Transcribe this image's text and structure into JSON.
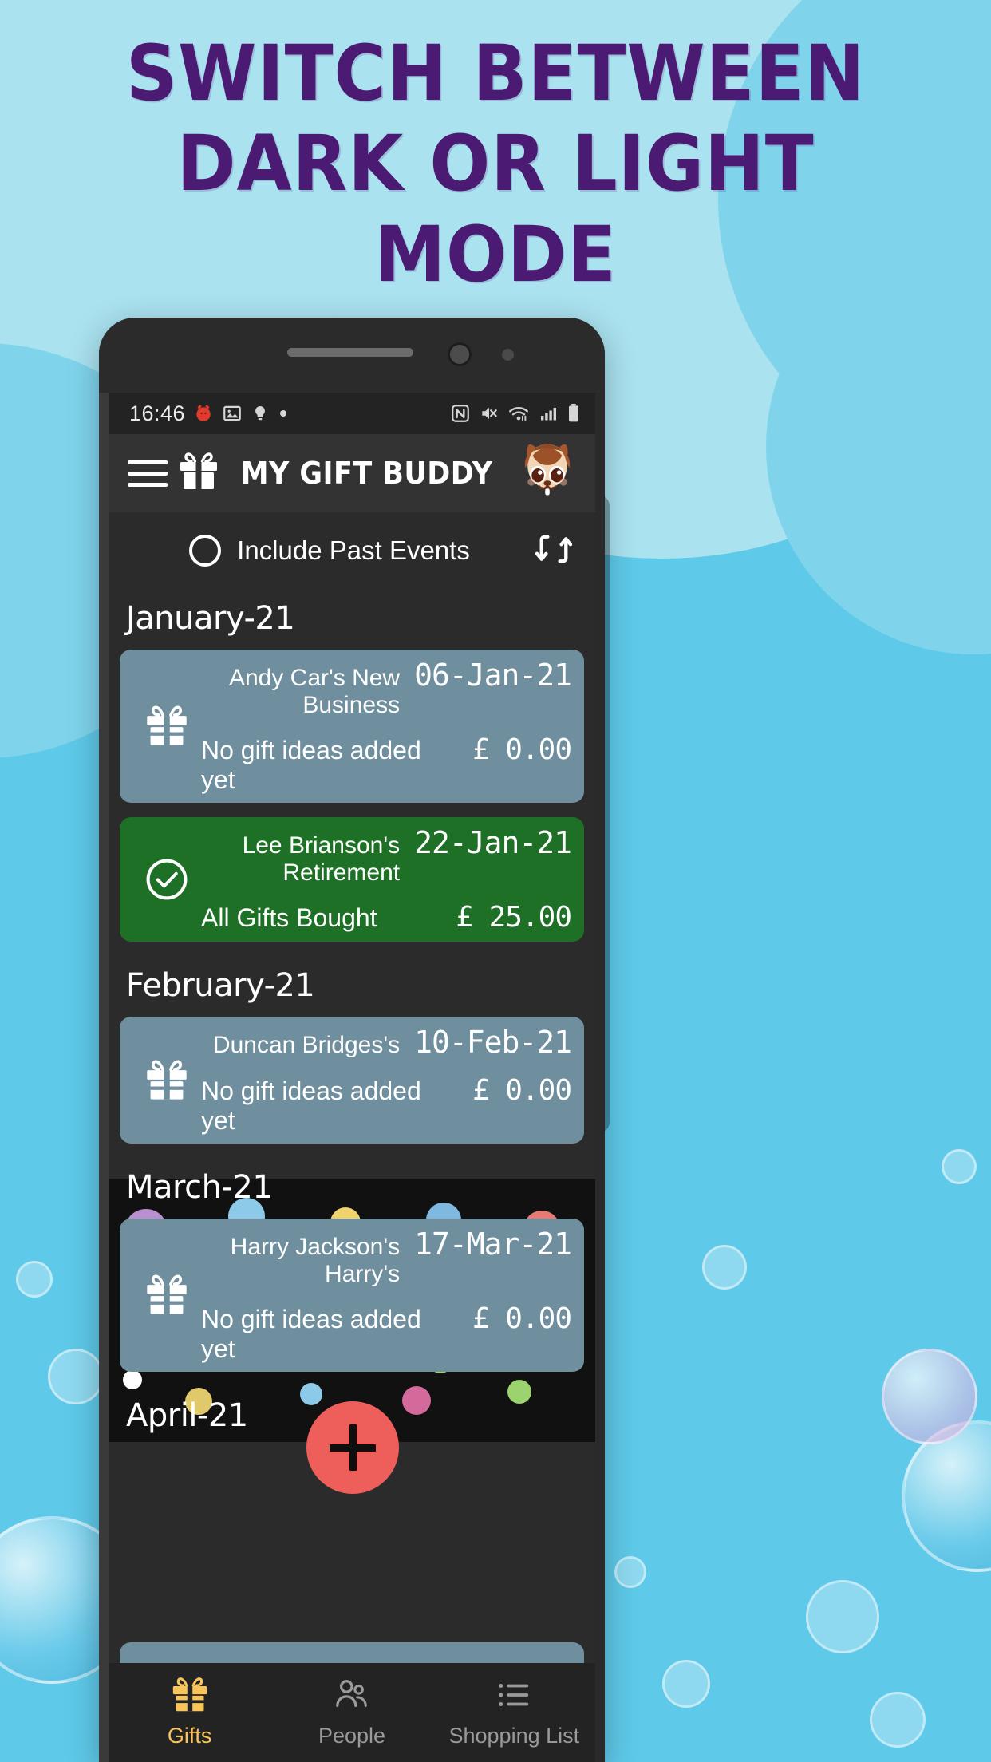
{
  "promo": {
    "headline_lines": [
      "Switch Between",
      "Dark or Light",
      "Mode"
    ],
    "headline_color": "#4b1b74",
    "background_color": "#5ec9e8"
  },
  "status_bar": {
    "time": "16:46",
    "icons": [
      "alarm-icon",
      "image-icon",
      "bulb-icon",
      "dot-icon",
      "nfc-icon",
      "mute-icon",
      "wifi-icon",
      "signal-icon",
      "battery-icon"
    ]
  },
  "app_bar": {
    "menu_icon": "hamburger-menu-icon",
    "logo_icon": "gift-icon",
    "title": "MY GIFT BUDDY",
    "avatar_icon": "squirrel-avatar-icon"
  },
  "filter_bar": {
    "toggle_label": "Include Past Events",
    "toggle_selected": false,
    "sort_icon": "sort-swap-icon"
  },
  "groups": [
    {
      "month": "January-21",
      "events": [
        {
          "icon": "gift-icon",
          "title": "Andy Car's New Business",
          "date": "06-Jan-21",
          "subtitle": "No gift ideas added yet",
          "amount": "£ 0.00",
          "status": "pending",
          "color": "#6f8e9e"
        },
        {
          "icon": "check-circle-icon",
          "title": "Lee Brianson's Retirement",
          "date": "22-Jan-21",
          "subtitle": "All Gifts Bought",
          "amount": "£ 25.00",
          "status": "done",
          "color": "#1d7025"
        }
      ]
    },
    {
      "month": "February-21",
      "events": [
        {
          "icon": "gift-icon",
          "title": "Duncan Bridges's",
          "date": "10-Feb-21",
          "subtitle": "No gift ideas added yet",
          "amount": "£ 0.00",
          "status": "pending",
          "color": "#6f8e9e"
        }
      ]
    },
    {
      "month": "March-21",
      "events": [
        {
          "icon": "gift-icon",
          "title": "Harry Jackson's Harry's",
          "date": "17-Mar-21",
          "subtitle": "No gift ideas added yet",
          "amount": "£ 0.00",
          "status": "pending",
          "color": "#6f8e9e"
        }
      ]
    },
    {
      "month": "April-21",
      "events": []
    }
  ],
  "fab": {
    "icon": "plus-icon",
    "color": "#ee5f5b"
  },
  "bottom_nav": {
    "active_color": "#f9c55a",
    "inactive_color": "#9a9a9a",
    "items": [
      {
        "icon": "gift-icon",
        "label": "Gifts",
        "active": true
      },
      {
        "icon": "people-icon",
        "label": "People",
        "active": false
      },
      {
        "icon": "list-icon",
        "label": "Shopping List",
        "active": false
      }
    ]
  }
}
